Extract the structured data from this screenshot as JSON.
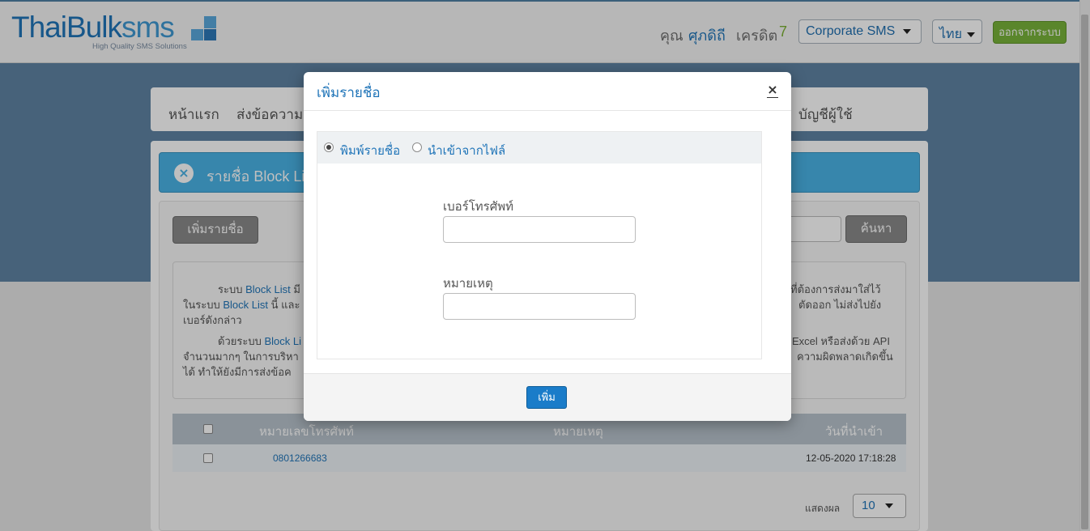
{
  "header": {
    "logo_main": "ThaiBulk",
    "logo_sms": "sms",
    "logo_tagline": "High Quality SMS Solutions",
    "greeting": "คุณ",
    "user_name": "ศุภดิถี",
    "credit_label": "เครดิต",
    "credit_value": "7",
    "account_type": "Corporate SMS",
    "language": "ไทย",
    "logout_label": "ออกจากระบบ"
  },
  "nav": {
    "items": [
      {
        "label": "หน้าแรก"
      },
      {
        "label": "ส่งข้อความ"
      },
      {
        "label": "บัญชีผู้ใช้"
      }
    ]
  },
  "page": {
    "title": "รายชื่อ Block List",
    "add_button": "เพิ่มรายชื่อ",
    "search_button": "ค้นหา"
  },
  "info": {
    "p1_l1_a": "ระบบ",
    "p1_l1_b": "Block List",
    "p1_l1_c": "มี",
    "p1_l1_right": "ที่ต้องการส่งมาใส่ไว้",
    "p1_l2_a": "ในระบบ",
    "p1_l2_b": "Block List",
    "p1_l2_c": "นี้ และ",
    "p1_l2_right": "ตัดออก ไม่ส่งไปยัง",
    "p1_l3": "เบอร์ดังกล่าว",
    "p2_l1_a": "ด้วยระบบ",
    "p2_l1_b": "Block Li",
    "p2_l1_right": "Excel หรือส่งด้วย API",
    "p2_l2": "จำนวนมากๆ ในการบริหา",
    "p2_l2_right": "ความผิดพลาดเกิดขึ้น",
    "p2_l3": "ได้ ทำให้ยังมีการส่งข้อค"
  },
  "table": {
    "columns": [
      "หมายเลขโทรศัพท์",
      "หมายเหตุ",
      "วันที่นำเข้า"
    ],
    "rows": [
      {
        "phone": "0801266683",
        "note": "",
        "date": "12-05-2020 17:18:28"
      }
    ]
  },
  "pager": {
    "label": "แสดงผล",
    "page_size": "10"
  },
  "modal": {
    "title": "เพิ่มรายชื่อ",
    "close_icon": "×",
    "radio_type": "พิมพ์รายชื่อ",
    "radio_import": "นำเข้าจากไฟล์",
    "selected_mode": "type",
    "phone_label": "เบอร์โทรศัพท์",
    "phone_value": "",
    "note_label": "หมายเหตุ",
    "note_value": "",
    "submit_label": "เพิ่ม"
  },
  "colors": {
    "brand_blue": "#1f74b8",
    "logout_green": "#79b33a",
    "banner_blue": "#4ab3e6",
    "primary_button": "#1a7cc9"
  }
}
